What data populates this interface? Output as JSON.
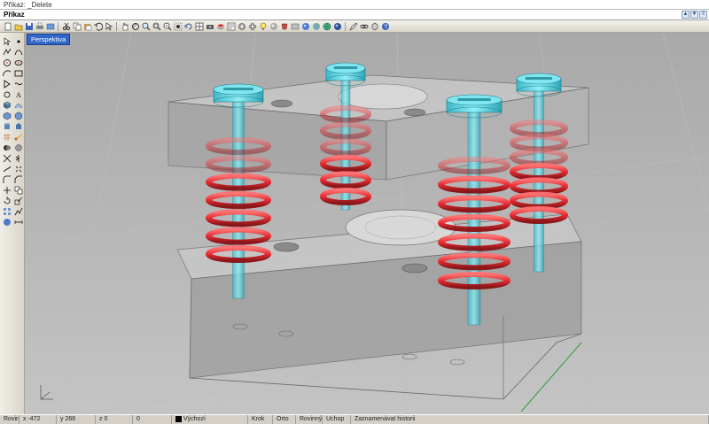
{
  "command": {
    "history": "Příkaz: _Delete",
    "label": "Příkaz:",
    "value": ""
  },
  "viewport": {
    "label": "Perspektiva"
  },
  "status": {
    "plane": "Rovina",
    "x": "x -472",
    "y": "y 266",
    "z": "z 0",
    "extra": "0",
    "layer": "Výchozí",
    "snap_grid": "Krok",
    "ortho": "Orto",
    "planar": "Rovinný",
    "osnap": "Uchop",
    "history": "Zaznamenávat historii"
  },
  "colors": {
    "spring": "#e8242a",
    "bolt": "#55d8e6",
    "block": "#a8a8a8",
    "viewport_bg": "#b5b5b5",
    "tab": "#2f66c8"
  }
}
